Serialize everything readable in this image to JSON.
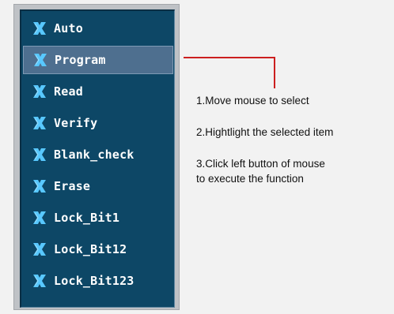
{
  "menu": {
    "items": [
      {
        "label": "Auto",
        "icon": "x-icon"
      },
      {
        "label": "Program",
        "icon": "x-icon",
        "selected": true
      },
      {
        "label": "Read",
        "icon": "x-icon"
      },
      {
        "label": "Verify",
        "icon": "x-icon"
      },
      {
        "label": "Blank_check",
        "icon": "x-icon"
      },
      {
        "label": "Erase",
        "icon": "x-icon"
      },
      {
        "label": "Lock_Bit1",
        "icon": "x-icon"
      },
      {
        "label": "Lock_Bit12",
        "icon": "x-icon"
      },
      {
        "label": "Lock_Bit123",
        "icon": "x-icon"
      }
    ]
  },
  "instructions": {
    "step1": "1.Move mouse to select",
    "step2": "2.Hightlight the selected item",
    "step3_line1": "3.Click left button of mouse",
    "step3_line2": "to execute the function"
  },
  "colors": {
    "panel": "#0d4766",
    "highlight": "#4e6f8f",
    "icon": "#58c8ff",
    "connector": "#cc1f1f"
  }
}
